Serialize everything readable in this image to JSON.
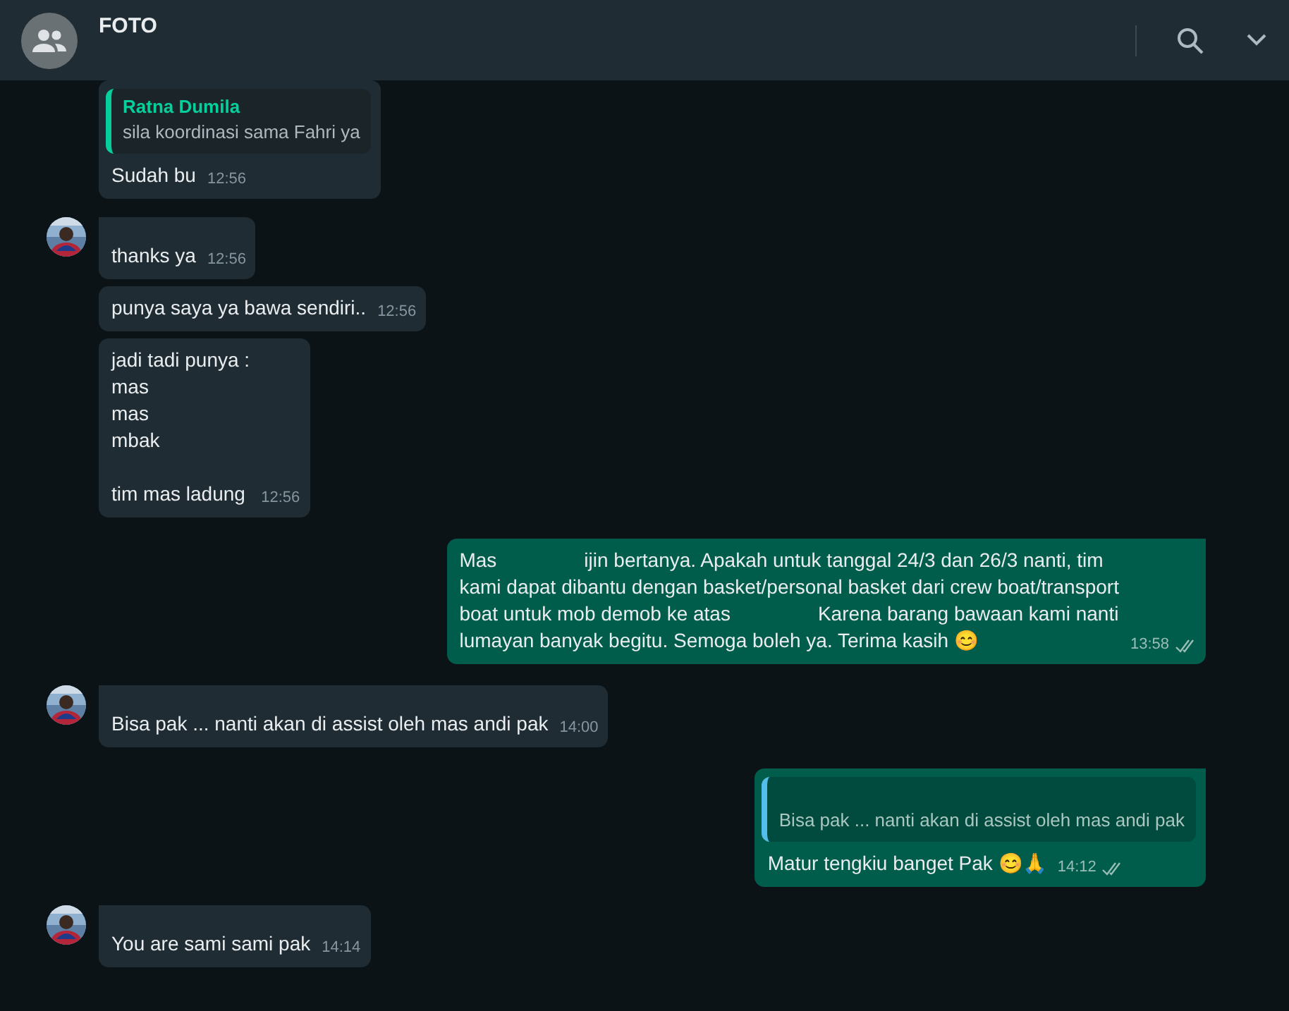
{
  "header": {
    "title": "FOTO"
  },
  "messages": [
    {
      "kind": "incoming",
      "avatar": false,
      "tail": false,
      "quote": {
        "author": "Ratna Dumila",
        "text": "sila koordinasi sama Fahri ya",
        "color": "#06cf9c"
      },
      "segments": [
        "Sudah bu"
      ],
      "time": "12:56"
    },
    {
      "kind": "incoming",
      "avatar": true,
      "tail": true,
      "segments": [
        "thanks ya"
      ],
      "time": "12:56"
    },
    {
      "kind": "incoming",
      "avatar": false,
      "tail": false,
      "segments": [
        "punya saya ya bawa sendiri.."
      ],
      "time": "12:56"
    },
    {
      "kind": "incoming",
      "avatar": false,
      "tail": false,
      "segments": [
        "jadi tadi punya :\nmas\nmas\nmbak\n\ntim mas ladung"
      ],
      "time": "12:56"
    },
    {
      "kind": "outgoing",
      "avatar": false,
      "tail": true,
      "segments": [
        "Mas",
        "ijin bertanya. Apakah untuk tanggal 24/3 dan 26/3 nanti, tim\nkami dapat dibantu dengan basket/personal basket dari crew boat/transport\nboat untuk mob demob ke atas",
        "Karena barang bawaan kami nanti\nlumayan banyak begitu. Semoga boleh ya. Terima kasih 😊"
      ],
      "time": "13:58"
    },
    {
      "kind": "incoming",
      "avatar": true,
      "tail": true,
      "segments": [
        "Bisa pak ... nanti akan di assist oleh mas andi pak"
      ],
      "time": "14:00"
    },
    {
      "kind": "outgoing",
      "avatar": false,
      "tail": true,
      "quote": {
        "text": "Bisa pak ... nanti akan di assist oleh mas andi pak",
        "color": "#53bdeb"
      },
      "segments": [
        "Matur tengkiu banget Pak 😊🙏"
      ],
      "time": "14:12"
    },
    {
      "kind": "incoming",
      "avatar": true,
      "tail": true,
      "segments": [
        "You are sami sami pak"
      ],
      "time": "14:14"
    }
  ]
}
